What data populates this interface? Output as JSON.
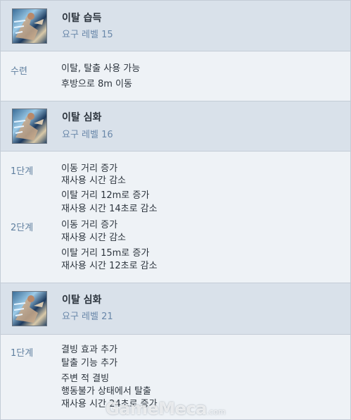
{
  "skills": [
    {
      "icon": "runner-skill-icon",
      "title": "이탈 습득",
      "level": "요구 레벨 15",
      "rows": [
        {
          "label": "수련",
          "lines": [
            "이탈, 탈출 사용 가능",
            "후방으로 8m 이동"
          ]
        }
      ]
    },
    {
      "icon": "runner-skill-icon",
      "title": "이탈 심화",
      "level": "요구 레벨 16",
      "rows": [
        {
          "label": "1단계",
          "lines": [
            "이동 거리 증가",
            "재사용 시간 감소",
            "이탈 거리 12m로 증가",
            "재사용 시간 14초로 감소"
          ]
        },
        {
          "label": "2단계",
          "lines": [
            "이동 거리 증가",
            "재사용 시간 감소",
            "이탈 거리 15m로 증가",
            "재사용 시간 12초로 감소"
          ]
        }
      ]
    },
    {
      "icon": "runner-skill-icon",
      "title": "이탈 심화",
      "level": "요구 레벨 21",
      "rows": [
        {
          "label": "1단계",
          "lines": [
            "결빙 효과 추가",
            "탈출 기능 추가",
            "주변 적 결빙",
            "행동불가 상태에서 탈출",
            "재사용 시간 24초로 증가"
          ]
        }
      ]
    }
  ],
  "watermark": {
    "text": "GameMeca",
    "suffix": ".com"
  }
}
